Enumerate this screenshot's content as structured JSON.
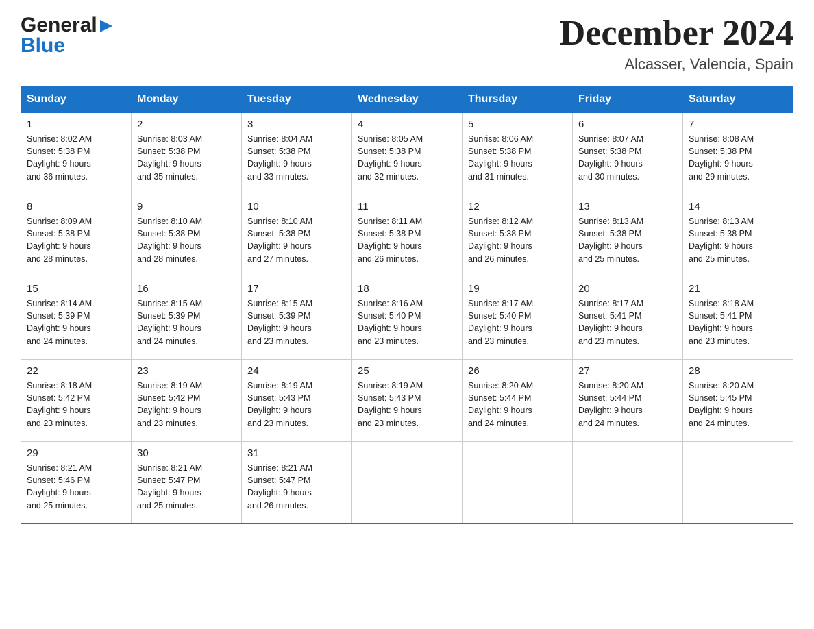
{
  "header": {
    "month_title": "December 2024",
    "location": "Alcasser, Valencia, Spain",
    "logo_general": "General",
    "logo_blue": "Blue"
  },
  "weekdays": [
    "Sunday",
    "Monday",
    "Tuesday",
    "Wednesday",
    "Thursday",
    "Friday",
    "Saturday"
  ],
  "weeks": [
    [
      {
        "day": "1",
        "sunrise": "8:02 AM",
        "sunset": "5:38 PM",
        "daylight": "9 hours and 36 minutes."
      },
      {
        "day": "2",
        "sunrise": "8:03 AM",
        "sunset": "5:38 PM",
        "daylight": "9 hours and 35 minutes."
      },
      {
        "day": "3",
        "sunrise": "8:04 AM",
        "sunset": "5:38 PM",
        "daylight": "9 hours and 33 minutes."
      },
      {
        "day": "4",
        "sunrise": "8:05 AM",
        "sunset": "5:38 PM",
        "daylight": "9 hours and 32 minutes."
      },
      {
        "day": "5",
        "sunrise": "8:06 AM",
        "sunset": "5:38 PM",
        "daylight": "9 hours and 31 minutes."
      },
      {
        "day": "6",
        "sunrise": "8:07 AM",
        "sunset": "5:38 PM",
        "daylight": "9 hours and 30 minutes."
      },
      {
        "day": "7",
        "sunrise": "8:08 AM",
        "sunset": "5:38 PM",
        "daylight": "9 hours and 29 minutes."
      }
    ],
    [
      {
        "day": "8",
        "sunrise": "8:09 AM",
        "sunset": "5:38 PM",
        "daylight": "9 hours and 28 minutes."
      },
      {
        "day": "9",
        "sunrise": "8:10 AM",
        "sunset": "5:38 PM",
        "daylight": "9 hours and 28 minutes."
      },
      {
        "day": "10",
        "sunrise": "8:10 AM",
        "sunset": "5:38 PM",
        "daylight": "9 hours and 27 minutes."
      },
      {
        "day": "11",
        "sunrise": "8:11 AM",
        "sunset": "5:38 PM",
        "daylight": "9 hours and 26 minutes."
      },
      {
        "day": "12",
        "sunrise": "8:12 AM",
        "sunset": "5:38 PM",
        "daylight": "9 hours and 26 minutes."
      },
      {
        "day": "13",
        "sunrise": "8:13 AM",
        "sunset": "5:38 PM",
        "daylight": "9 hours and 25 minutes."
      },
      {
        "day": "14",
        "sunrise": "8:13 AM",
        "sunset": "5:38 PM",
        "daylight": "9 hours and 25 minutes."
      }
    ],
    [
      {
        "day": "15",
        "sunrise": "8:14 AM",
        "sunset": "5:39 PM",
        "daylight": "9 hours and 24 minutes."
      },
      {
        "day": "16",
        "sunrise": "8:15 AM",
        "sunset": "5:39 PM",
        "daylight": "9 hours and 24 minutes."
      },
      {
        "day": "17",
        "sunrise": "8:15 AM",
        "sunset": "5:39 PM",
        "daylight": "9 hours and 23 minutes."
      },
      {
        "day": "18",
        "sunrise": "8:16 AM",
        "sunset": "5:40 PM",
        "daylight": "9 hours and 23 minutes."
      },
      {
        "day": "19",
        "sunrise": "8:17 AM",
        "sunset": "5:40 PM",
        "daylight": "9 hours and 23 minutes."
      },
      {
        "day": "20",
        "sunrise": "8:17 AM",
        "sunset": "5:41 PM",
        "daylight": "9 hours and 23 minutes."
      },
      {
        "day": "21",
        "sunrise": "8:18 AM",
        "sunset": "5:41 PM",
        "daylight": "9 hours and 23 minutes."
      }
    ],
    [
      {
        "day": "22",
        "sunrise": "8:18 AM",
        "sunset": "5:42 PM",
        "daylight": "9 hours and 23 minutes."
      },
      {
        "day": "23",
        "sunrise": "8:19 AM",
        "sunset": "5:42 PM",
        "daylight": "9 hours and 23 minutes."
      },
      {
        "day": "24",
        "sunrise": "8:19 AM",
        "sunset": "5:43 PM",
        "daylight": "9 hours and 23 minutes."
      },
      {
        "day": "25",
        "sunrise": "8:19 AM",
        "sunset": "5:43 PM",
        "daylight": "9 hours and 23 minutes."
      },
      {
        "day": "26",
        "sunrise": "8:20 AM",
        "sunset": "5:44 PM",
        "daylight": "9 hours and 24 minutes."
      },
      {
        "day": "27",
        "sunrise": "8:20 AM",
        "sunset": "5:44 PM",
        "daylight": "9 hours and 24 minutes."
      },
      {
        "day": "28",
        "sunrise": "8:20 AM",
        "sunset": "5:45 PM",
        "daylight": "9 hours and 24 minutes."
      }
    ],
    [
      {
        "day": "29",
        "sunrise": "8:21 AM",
        "sunset": "5:46 PM",
        "daylight": "9 hours and 25 minutes."
      },
      {
        "day": "30",
        "sunrise": "8:21 AM",
        "sunset": "5:47 PM",
        "daylight": "9 hours and 25 minutes."
      },
      {
        "day": "31",
        "sunrise": "8:21 AM",
        "sunset": "5:47 PM",
        "daylight": "9 hours and 26 minutes."
      },
      null,
      null,
      null,
      null
    ]
  ],
  "labels": {
    "sunrise": "Sunrise:",
    "sunset": "Sunset:",
    "daylight": "Daylight:"
  }
}
